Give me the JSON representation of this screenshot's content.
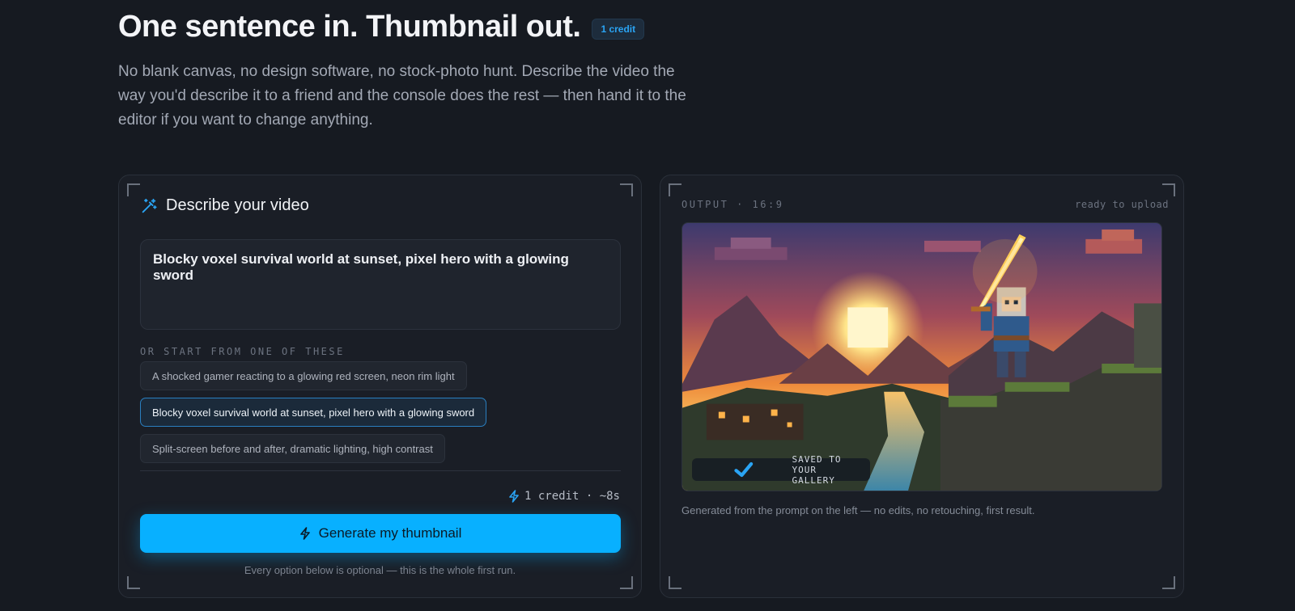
{
  "hero": {
    "title": "One sentence in. Thumbnail out.",
    "badge": "1 credit",
    "subtitle": "No blank canvas, no design software, no stock-photo hunt. Describe the video the way you'd describe it to a friend and the console does the rest — then hand it to the editor if you want to change anything."
  },
  "input_panel": {
    "icon": "magic-wand-icon",
    "heading": "Describe your video",
    "prompt_value": "Blocky voxel survival world at sunset, pixel hero with a glowing sword",
    "starter_caption": "OR START FROM ONE OF THESE",
    "starters": [
      {
        "label": "A shocked gamer reacting to a glowing red screen, neon rim light",
        "active": false
      },
      {
        "label": "Blocky voxel survival world at sunset, pixel hero with a glowing sword",
        "active": true
      },
      {
        "label": "Split-screen before and after, dramatic lighting, high contrast",
        "active": false
      }
    ],
    "cost_line": "1 credit · ~8s",
    "generate_label": "Generate my thumbnail",
    "footnote": "Every option below is optional — this is the whole first run."
  },
  "output_panel": {
    "caption_left": "OUTPUT · 16:9",
    "caption_right": "ready to upload",
    "image_alt": "Pixel-art voxel hero raising a glowing sword at sunset",
    "saved_badge": "SAVED TO YOUR GALLERY",
    "note": "Generated from the prompt on the left — no edits, no retouching, first result."
  },
  "colors": {
    "background": "#161a21",
    "panel": "#1a1e26",
    "accent": "#08b0ff",
    "badge_text": "#2aa4f4"
  }
}
